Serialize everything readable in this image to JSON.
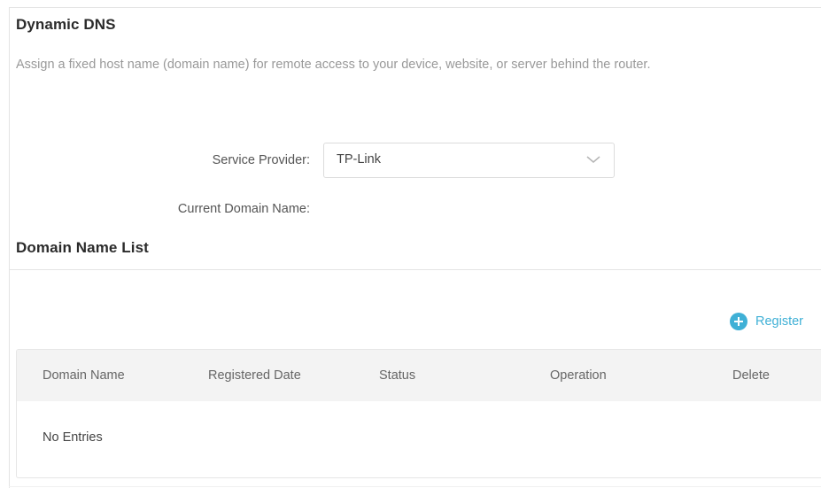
{
  "ddns": {
    "title": "Dynamic DNS",
    "description": "Assign a fixed host name (domain name) for remote access to your device, website, or server behind the router.",
    "service_provider_label": "Service Provider:",
    "service_provider_value": "TP-Link",
    "current_domain_label": "Current Domain Name:",
    "current_domain_value": ""
  },
  "domain_list": {
    "title": "Domain Name List",
    "register_label": "Register",
    "columns": [
      "Domain Name",
      "Registered Date",
      "Status",
      "Operation",
      "Delete"
    ],
    "empty_text": "No Entries"
  },
  "colors": {
    "accent": "#3fb0d6",
    "header_bg": "#f3f3f3",
    "border": "#e4e4e4"
  },
  "icons": {
    "register": "plus-circle-icon",
    "dropdown": "chevron-down-icon"
  }
}
